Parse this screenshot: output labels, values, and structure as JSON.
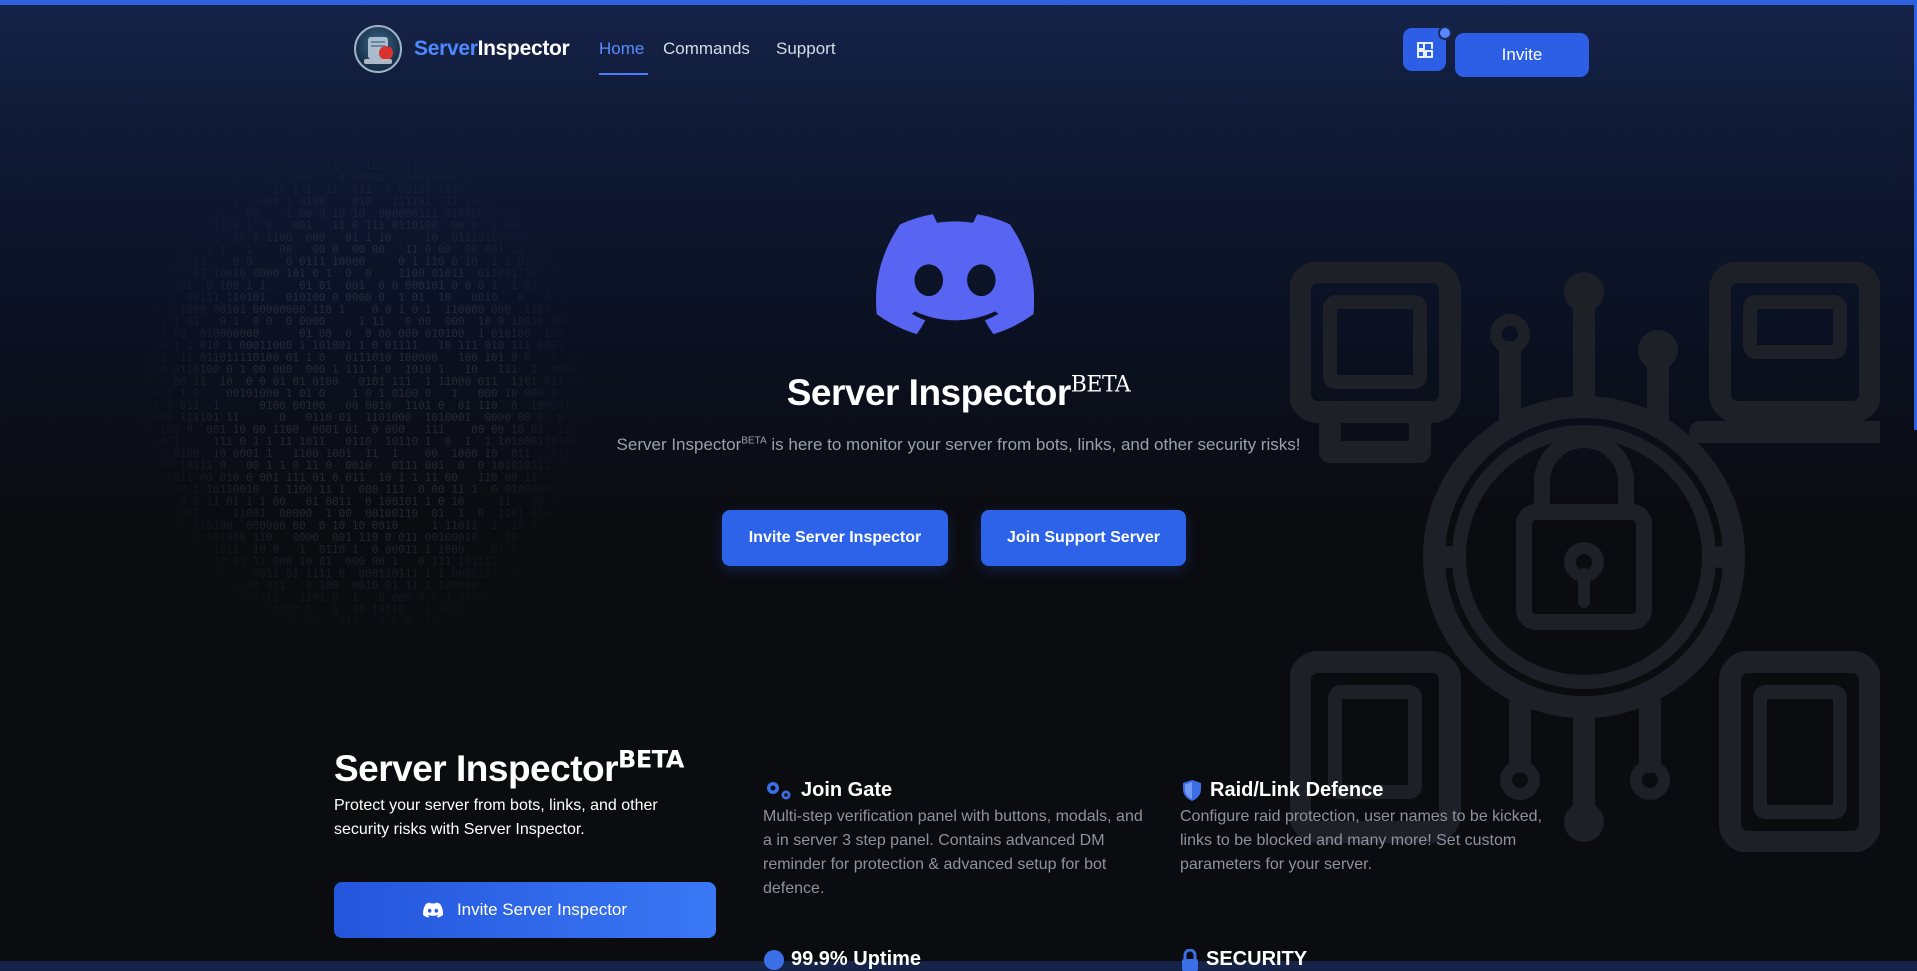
{
  "nav": {
    "brand_part1": "Server",
    "brand_part2": "Inspector",
    "links": [
      "Home",
      "Commands",
      "Support"
    ],
    "invite_label": "Invite",
    "icon": "dashboard-icon"
  },
  "hero": {
    "title": "Server Inspector",
    "title_sup": "BETA",
    "subtitle_name": "Server Inspector",
    "subtitle_sup": "BETA",
    "subtitle_rest": " is here to monitor your server from bots, links, and other security risks!",
    "btn_invite": "Invite Server Inspector",
    "btn_support": "Join Support Server"
  },
  "section": {
    "title": "Server Inspector",
    "title_sup": "BETA",
    "description": "Protect your server from bots, links, and other security risks with Server Inspector.",
    "invite_label": "Invite Server Inspector"
  },
  "features": [
    {
      "icon": "gears-icon",
      "title": "Join Gate",
      "desc": "Multi-step verification panel with buttons, modals, and a in server 3 step panel. Contains advanced DM reminder for protection & advanced setup for bot defence."
    },
    {
      "icon": "shield-icon",
      "title": "Raid/Link Defence",
      "desc": "Configure raid protection, user names to be kicked, links to be blocked and many more! Set custom parameters for your server."
    },
    {
      "icon": "info-icon",
      "title": "99.9% Uptime"
    },
    {
      "icon": "lock-icon",
      "title": "SECURITY"
    }
  ],
  "colors": {
    "accent": "#2d63e8",
    "link_active": "#5b8cff",
    "background": "#0b0c10"
  }
}
